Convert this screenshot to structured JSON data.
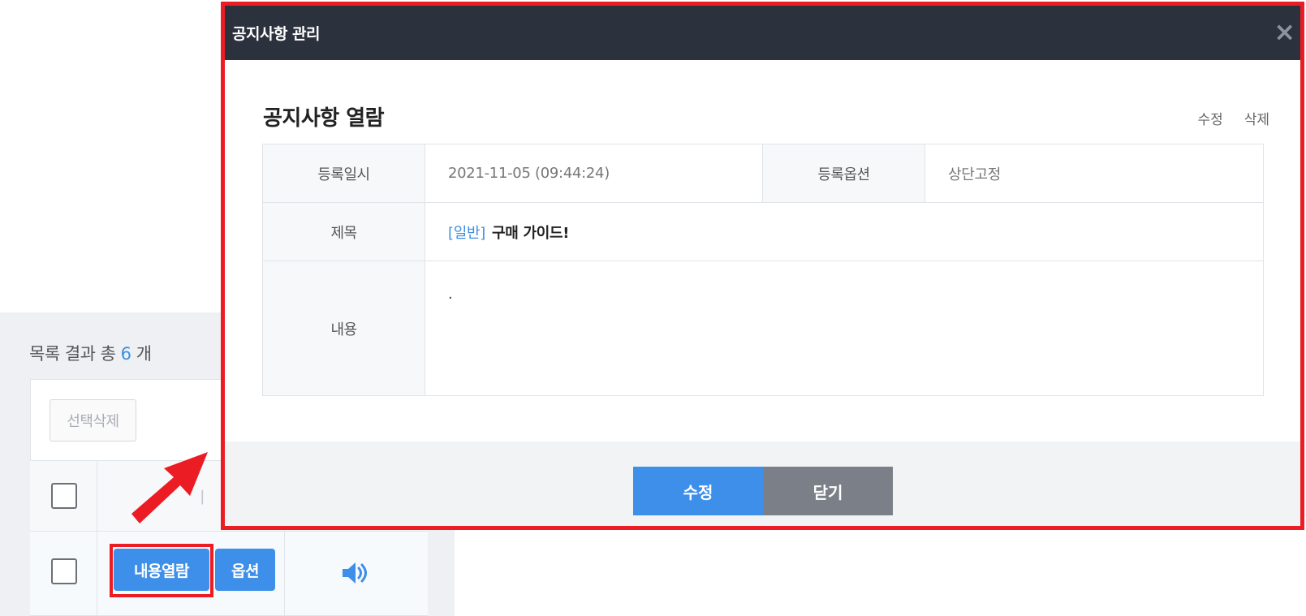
{
  "background": {
    "result": {
      "prefix": "목록 결과 총",
      "count": "6",
      "suffix": "개"
    },
    "delete_selected_label": "선택삭제",
    "row_buttons": {
      "view_content": "내용열람",
      "options": "옵션"
    }
  },
  "modal": {
    "title": "공지사항 관리",
    "close_symbol": "×",
    "section_title": "공지사항 열람",
    "links": {
      "edit": "수정",
      "delete": "삭제"
    },
    "fields": {
      "registered_at_label": "등록일시",
      "registered_at_value": "2021-11-05 (09:44:24)",
      "option_label": "등록옵션",
      "option_value": "상단고정",
      "subject_label": "제목",
      "subject_category": "[일반]",
      "subject_value": "구매 가이드!",
      "content_label": "내용",
      "content_value": "."
    },
    "footer": {
      "edit_label": "수정",
      "close_label": "닫기"
    }
  },
  "colors": {
    "accent": "#3d8fe9",
    "header": "#2b313d",
    "highlight": "#ec1c24"
  },
  "icons": {
    "speaker": "speaker-icon",
    "arrow": "red-arrow-icon",
    "close": "close-icon"
  }
}
